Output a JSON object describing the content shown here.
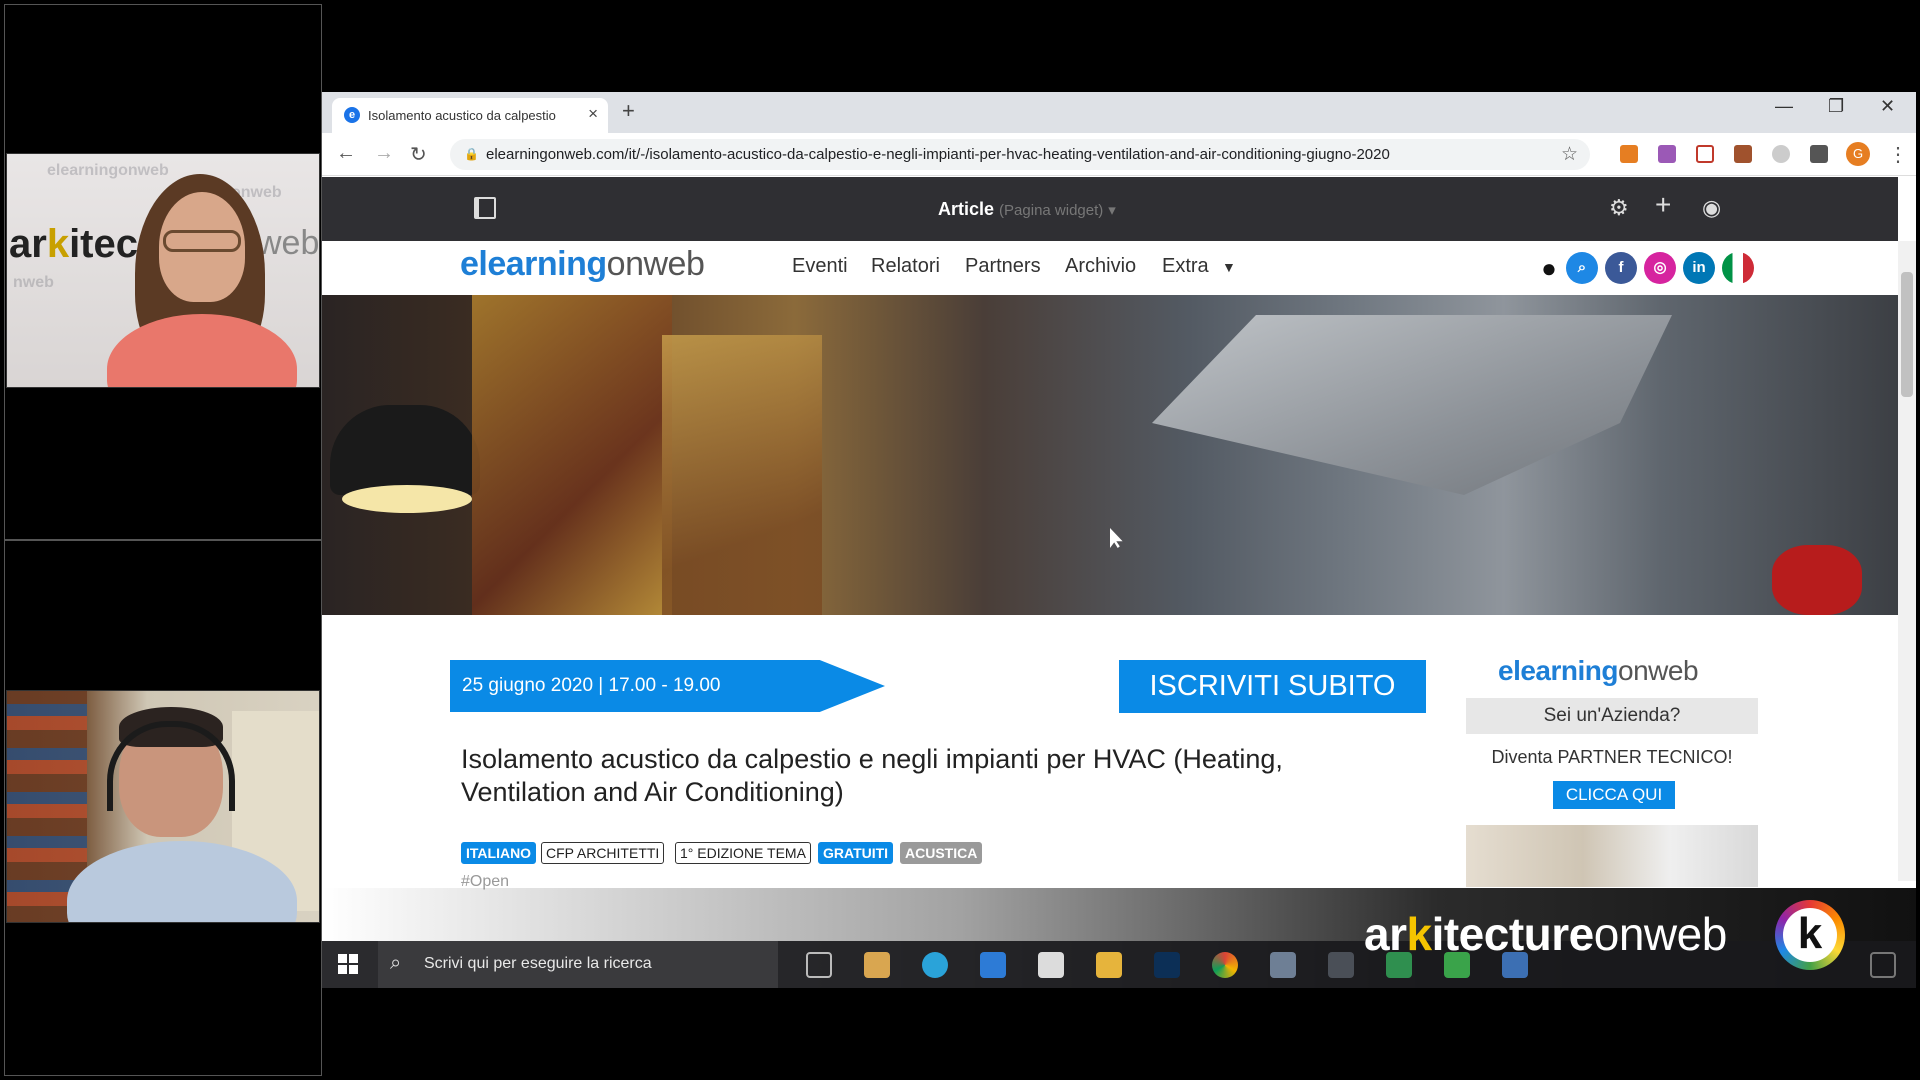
{
  "browser": {
    "tab_title": "Isolamento acustico da calpestio",
    "tab_icon": "e",
    "new_tab": "+",
    "url": "elearningonweb.com/it/-/isolamento-acustico-da-calpestio-e-negli-impianti-per-hvac-heating-ventilation-and-air-conditioning-giugno-2020",
    "profile_initial": "G"
  },
  "admin_bar": {
    "title": "Article",
    "subtitle": "(Pagina widget)"
  },
  "site": {
    "logo_e": "e",
    "logo_learning": "learning",
    "logo_onweb": "onweb",
    "nav": [
      "Eventi",
      "Relatori",
      "Partners",
      "Archivio",
      "Extra"
    ],
    "social": {
      "linkedin": "in"
    }
  },
  "event": {
    "date": "25 giugno 2020 | 17.00 - 19.00",
    "cta": "ISCRIVITI SUBITO",
    "title": "Isolamento acustico da calpestio e negli impianti per HVAC (Heating, Ventilation and Air Conditioning)",
    "tags": [
      "ITALIANO",
      "CFP ARCHITETTI",
      "1° EDIZIONE TEMA",
      "GRATUITI",
      "ACUSTICA"
    ],
    "open_tag": "#Open"
  },
  "sidebar": {
    "logo_e": "e",
    "logo_learning": "learning",
    "logo_onweb": "onweb",
    "question": "Sei un'Azienda?",
    "pitch": "Diventa PARTNER TECNICO!",
    "button": "CLICCA QUI"
  },
  "overlay_brand": {
    "ar": "ar",
    "k": "k",
    "itecture": "itecture",
    "onweb": "onweb",
    "badge": "k"
  },
  "taskbar": {
    "search_placeholder": "Scrivi qui per eseguire la ricerca"
  },
  "colors": {
    "accent": "#0a8ae6",
    "admin_bar": "#2f2f33",
    "brand_yellow": "#f5c400"
  }
}
